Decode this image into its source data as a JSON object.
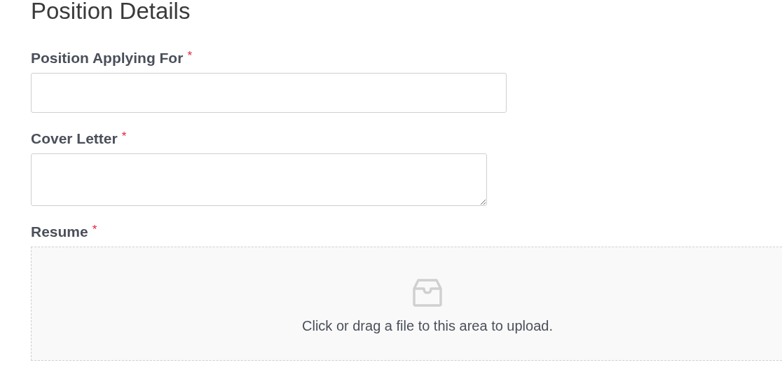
{
  "section": {
    "title": "Position Details"
  },
  "fields": [
    {
      "kind": "text",
      "label": "Position Applying For",
      "required_mark": "*"
    },
    {
      "kind": "textarea",
      "label": "Cover Letter",
      "required_mark": "*"
    },
    {
      "kind": "upload",
      "label": "Resume",
      "required_mark": "*",
      "prompt": "Click or drag a file to this area to upload."
    }
  ]
}
